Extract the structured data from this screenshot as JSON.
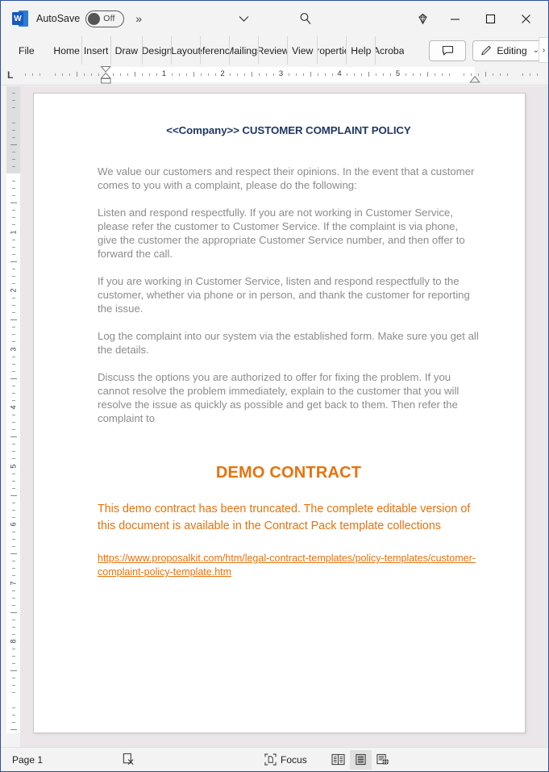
{
  "titlebar": {
    "app_logo": "word-logo",
    "logo_letter": "W",
    "autosave_label": "AutoSave",
    "autosave_state": "Off",
    "more_commands": "»",
    "customize_caret": "⌄",
    "search_icon": "search-icon",
    "premium_icon": "diamond-icon",
    "minimize": "—",
    "maximize": "□",
    "close": "✕"
  },
  "ribbon": {
    "tabs": [
      {
        "label": "File"
      },
      {
        "label": "Home"
      },
      {
        "label": "Insert"
      },
      {
        "label": "Draw"
      },
      {
        "label": "Design"
      },
      {
        "label": "Layout"
      },
      {
        "label": "References"
      },
      {
        "label": "Mailings"
      },
      {
        "label": "Review"
      },
      {
        "label": "View"
      },
      {
        "label": "Properties"
      },
      {
        "label": "Help"
      },
      {
        "label": "Acrobat"
      }
    ],
    "comments_icon": "comment-icon",
    "editing_label": "Editing",
    "editing_icon": "pencil-icon",
    "editing_caret": "⌄",
    "overflow_caret": "›"
  },
  "ruler": {
    "tab_stop_type": "L",
    "horizontal_numbers": [
      "1",
      "2",
      "3",
      "4",
      "5"
    ],
    "vertical_numbers": [
      "1",
      "2",
      "3",
      "4",
      "5",
      "6",
      "7",
      "8"
    ]
  },
  "document": {
    "title": "<<Company>> CUSTOMER COMPLAINT POLICY",
    "title_color": "#1f3864",
    "body_color": "#8c8c8c",
    "paragraphs": [
      "We value our customers and respect their opinions. In the event that a customer comes to you with a complaint, please do the following:",
      "Listen and respond respectfully. If you are not working in Customer Service, please refer the customer to Customer Service. If the complaint is via phone, give the customer the appropriate Customer Service number, and then offer to forward the call.",
      "If you are working in Customer Service, listen and respond respectfully to the customer, whether via phone or in person, and thank the customer for reporting the issue.",
      "Log the complaint into our system via the established form. Make sure you get all the details.",
      "Discuss the options you are authorized to offer for fixing the problem.  If you cannot resolve the problem immediately, explain to the customer that you will resolve the issue as quickly as possible and get back to them. Then refer the complaint to"
    ],
    "demo": {
      "heading": "DEMO CONTRACT",
      "body": "This demo contract has been truncated. The complete editable version of this document is available in the Contract Pack template collections",
      "link": "https://www.proposalkit.com/htm/legal-contract-templates/policy-templates/customer-complaint-policy-template.htm",
      "color": "#e8720c"
    }
  },
  "statusbar": {
    "page_label": "Page 1",
    "proofing_icon": "proofing-errors-icon",
    "focus_label": "Focus",
    "focus_icon": "focus-icon",
    "view_read_icon": "read-mode-icon",
    "view_print_icon": "print-layout-icon",
    "view_web_icon": "web-layout-icon"
  }
}
